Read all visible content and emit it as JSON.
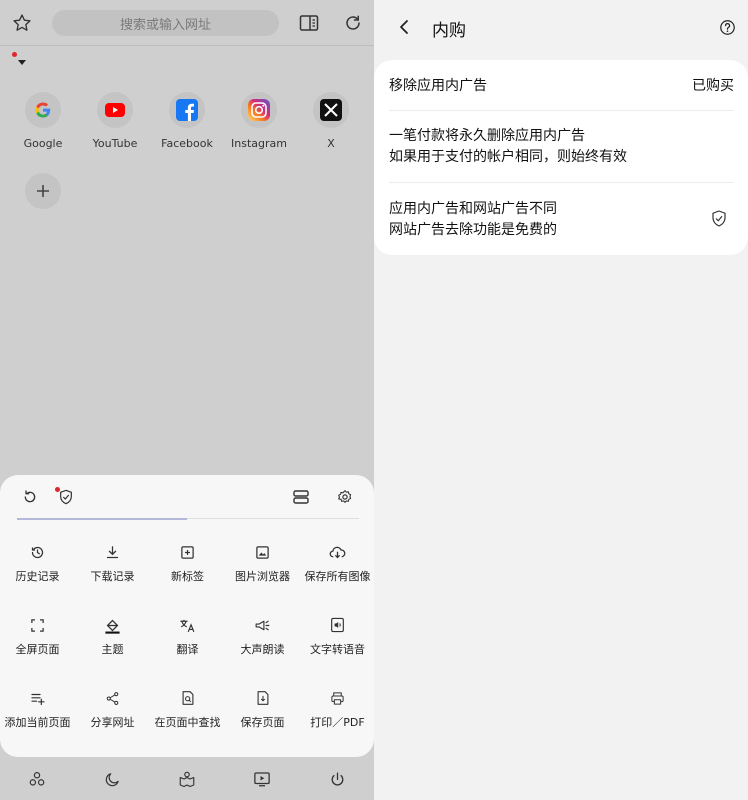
{
  "left": {
    "url_placeholder": "搜索或输入网址",
    "shortcuts": [
      {
        "label": "Google",
        "icon": "google-icon"
      },
      {
        "label": "YouTube",
        "icon": "youtube-icon"
      },
      {
        "label": "Facebook",
        "icon": "facebook-icon"
      },
      {
        "label": "Instagram",
        "icon": "instagram-icon"
      },
      {
        "label": "X",
        "icon": "x-icon"
      }
    ],
    "menu": {
      "row1": [
        "历史记录",
        "下载记录",
        "新标签",
        "图片浏览器",
        "保存所有图像"
      ],
      "row2": [
        "全屏页面",
        "主题",
        "翻译",
        "大声朗读",
        "文字转语音"
      ],
      "row3": [
        "添加当前页面",
        "分享网址",
        "在页面中查找",
        "保存页面",
        "打印／PDF"
      ]
    }
  },
  "right": {
    "title": "内购",
    "row1": {
      "label": "移除应用内广告",
      "value": "已购买"
    },
    "row2": {
      "line1": "一笔付款将永久删除应用内广告",
      "line2": "如果用于支付的帐户相同，则始终有效"
    },
    "row3": {
      "line1": "应用内广告和网站广告不同",
      "line2": "网站广告去除功能是免费的"
    }
  },
  "colors": {
    "accent_red": "#e0252b",
    "youtube_red": "#ff0000",
    "facebook_blue": "#1877f2"
  }
}
